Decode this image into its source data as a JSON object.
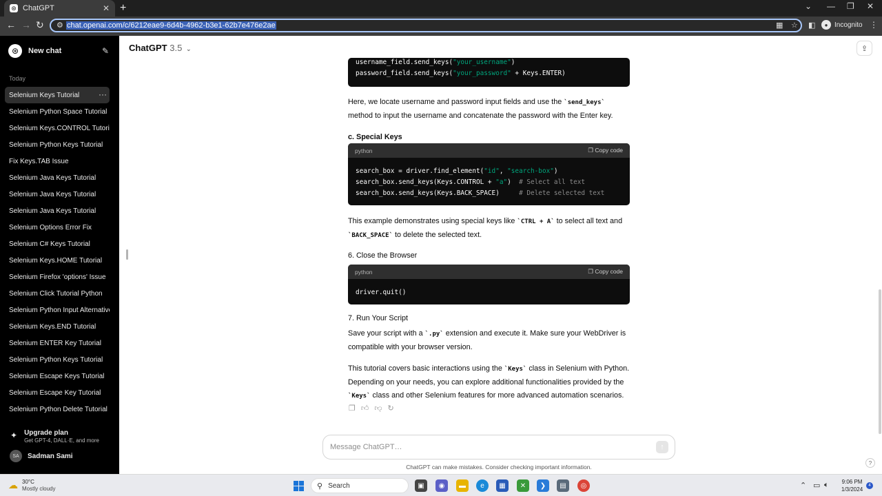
{
  "browser": {
    "tab_title": "ChatGPT",
    "tab_favicon": "⊛",
    "url": "chat.openai.com/c/6212eae9-6d4b-4962-b3e1-62b7e476e2ae",
    "profile_label": "Incognito"
  },
  "sidebar": {
    "new_chat_label": "New chat",
    "section_today": "Today",
    "items": [
      "Selenium Keys Tutorial",
      "Selenium Python Space Tutorial",
      "Selenium Keys.CONTROL Tutorial",
      "Selenium Python Keys Tutorial",
      "Fix Keys.TAB Issue",
      "Selenium Java Keys Tutorial",
      "Selenium Java Keys Tutorial",
      "Selenium Java Keys Tutorial",
      "Selenium Options Error Fix",
      "Selenium C# Keys Tutorial",
      "Selenium Keys.HOME Tutorial",
      "Selenium Firefox 'options' Issue",
      "Selenium Click Tutorial Python",
      "Selenium Python Input Alternative",
      "Selenium Keys.END Tutorial",
      "Selenium ENTER Key Tutorial",
      "Selenium Python Keys Tutorial",
      "Selenium Escape Keys Tutorial",
      "Selenium Escape Key Tutorial",
      "Selenium Python Delete Tutorial"
    ],
    "upgrade_title": "Upgrade plan",
    "upgrade_sub": "Get GPT-4, DALL·E, and more",
    "user_initials": "SA",
    "user_name": "Sadman Sami"
  },
  "header": {
    "model_name": "ChatGPT",
    "model_version": "3.5"
  },
  "content": {
    "code1_line1": "username_field.send_keys(",
    "code1_line1_str": "\"your_username\"",
    "code1_line1_end": ")",
    "code1_line2": "password_field.send_keys(",
    "code1_line2_str": "\"your_password\"",
    "code1_line2_end": " + Keys.ENTER)",
    "para1_a": "Here, we locate username and password input fields and use the ",
    "para1_code": "`send_keys`",
    "para1_b": " method to input the username and concatenate the password with the Enter key.",
    "heading_c": "c. Special Keys",
    "code_lang": "python",
    "copy_label": "Copy code",
    "code2_l1_a": "search_box = driver.find_element(",
    "code2_l1_s1": "\"id\"",
    "code2_l1_m": ", ",
    "code2_l1_s2": "\"search-box\"",
    "code2_l1_e": ")",
    "code2_l2_a": "search_box.send_keys(Keys.CONTROL + ",
    "code2_l2_s": "\"a\"",
    "code2_l2_e": ")  ",
    "code2_l2_c": "# Select all text",
    "code2_l3_a": "search_box.send_keys(Keys.BACK_SPACE)     ",
    "code2_l3_c": "# Delete selected text",
    "para2_a": "This example demonstrates using special keys like ",
    "para2_code1": "`CTRL + A`",
    "para2_b": " to select all text and ",
    "para2_code2": "`BACK_SPACE`",
    "para2_c": " to delete the selected text.",
    "heading_6": "6. Close the Browser",
    "code3_line": "driver.quit()",
    "heading_7": "7. Run Your Script",
    "para3_a": "Save your script with a ",
    "para3_code": "`.py`",
    "para3_b": " extension and execute it. Make sure your WebDriver is compatible with your browser version.",
    "para4_a": "This tutorial covers basic interactions using the ",
    "para4_code1": "`Keys`",
    "para4_b": " class in Selenium with Python. Depending on your needs, you can explore additional functionalities provided by the ",
    "para4_code2": "`Keys`",
    "para4_c": " class and other Selenium features for more advanced automation scenarios."
  },
  "composer": {
    "placeholder": "Message ChatGPT…",
    "disclaimer": "ChatGPT can make mistakes. Consider checking important information."
  },
  "taskbar": {
    "temp": "30°C",
    "weather": "Mostly cloudy",
    "search_label": "Search",
    "time": "9:06 PM",
    "date": "1/3/2024",
    "notif_count": "4"
  }
}
